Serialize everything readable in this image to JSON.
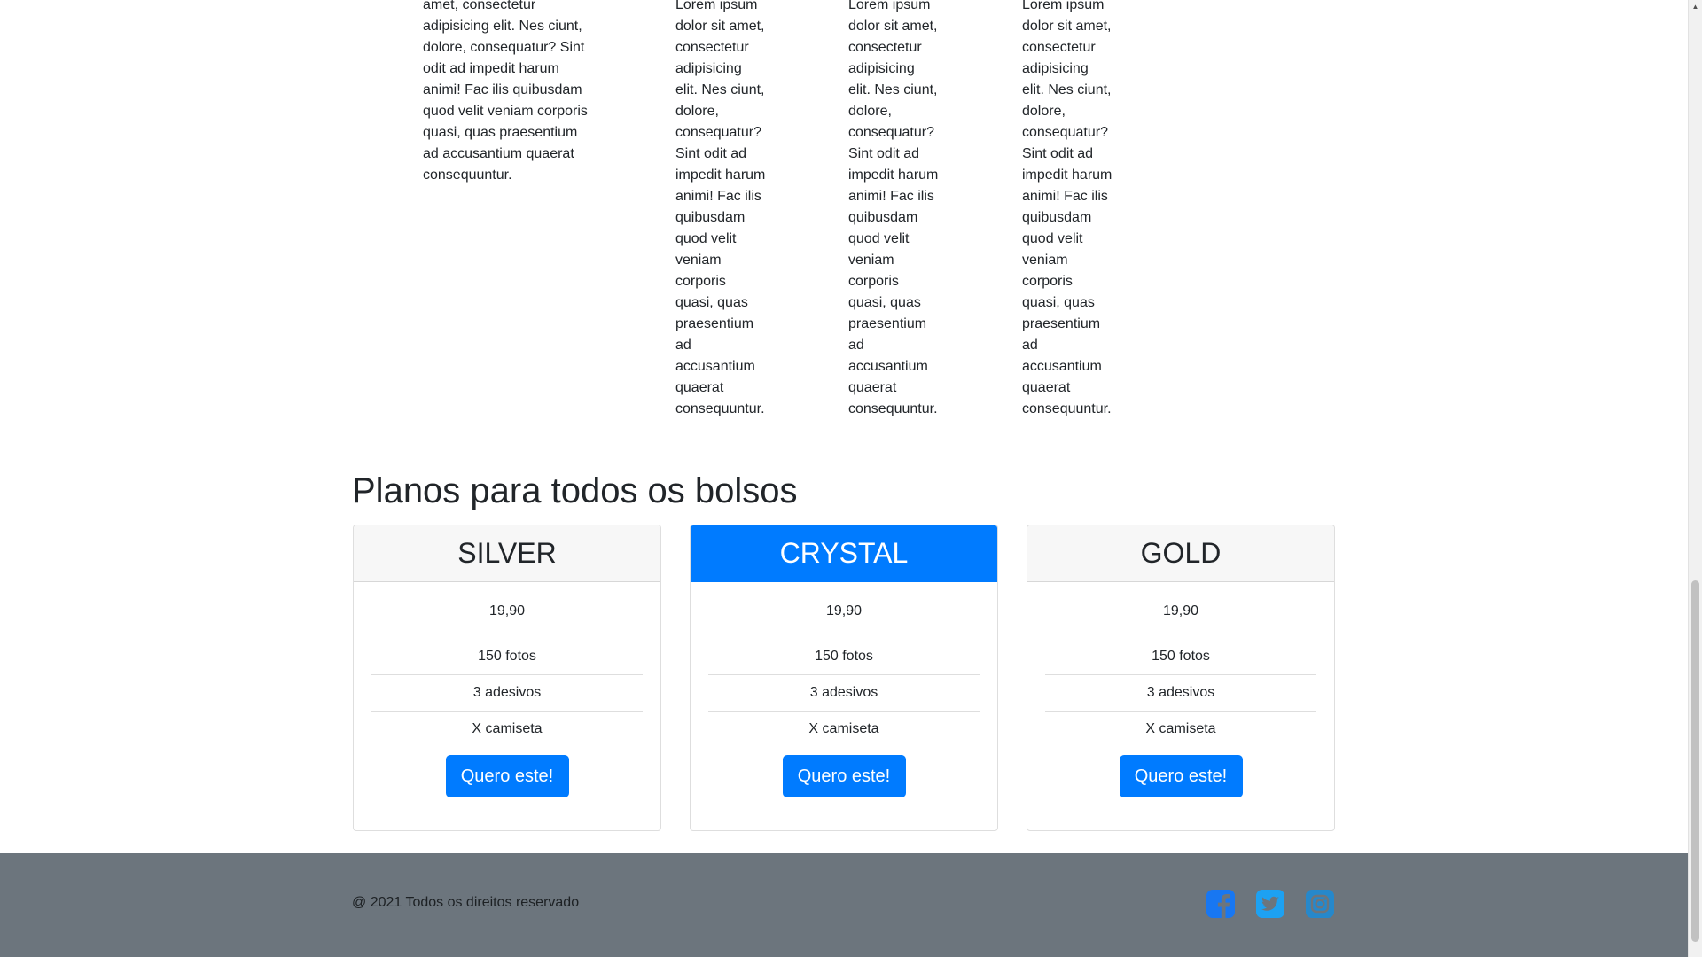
{
  "intro_columns": [
    "amet, consectetur adipisicing elit. Nes ciunt, dolore, consequatur? Sint odit ad impedit harum animi! Fac ilis quibusdam quod velit veniam corporis quasi, quas praesentium ad accusantium quaerat consequuntur.",
    "Lorem ipsum dolor sit amet, consectetur adipisicing elit. Nes ciunt, dolore, consequatur? Sint odit ad impedit harum animi! Fac ilis quibusdam quod velit veniam corporis quasi, quas praesentium ad accusantium quaerat consequuntur.",
    "Lorem ipsum dolor sit amet, consectetur adipisicing elit. Nes ciunt, dolore, consequatur? Sint odit ad impedit harum animi! Fac ilis quibusdam quod velit veniam corporis quasi, quas praesentium ad accusantium quaerat consequuntur.",
    "Lorem ipsum dolor sit amet, consectetur adipisicing elit. Nes ciunt, dolore, consequatur? Sint odit ad impedit harum animi! Fac ilis quibusdam quod velit veniam corporis quasi, quas praesentium ad accusantium quaerat consequuntur."
  ],
  "plans": {
    "title": "Planos para todos os bolsos",
    "cards": [
      {
        "name": "SILVER",
        "price": "19,90",
        "features": [
          "150 fotos",
          "3 adesivos",
          "X camiseta"
        ],
        "button": "Quero este!"
      },
      {
        "name": "CRYSTAL",
        "price": "19,90",
        "features": [
          "150 fotos",
          "3 adesivos",
          "X camiseta"
        ],
        "button": "Quero este!"
      },
      {
        "name": "GOLD",
        "price": "19,90",
        "features": [
          "150 fotos",
          "3 adesivos",
          "X camiseta"
        ],
        "button": "Quero este!"
      }
    ]
  },
  "footer": {
    "copyright": "@ 2021 Todos os direitos reservado",
    "social_icons": [
      "facebook-icon",
      "twitter-icon",
      "instagram-icon"
    ]
  },
  "colors": {
    "primary": "#007bff",
    "footer_bg": "#6c757d",
    "card_header_bg": "#f7f7f7"
  }
}
